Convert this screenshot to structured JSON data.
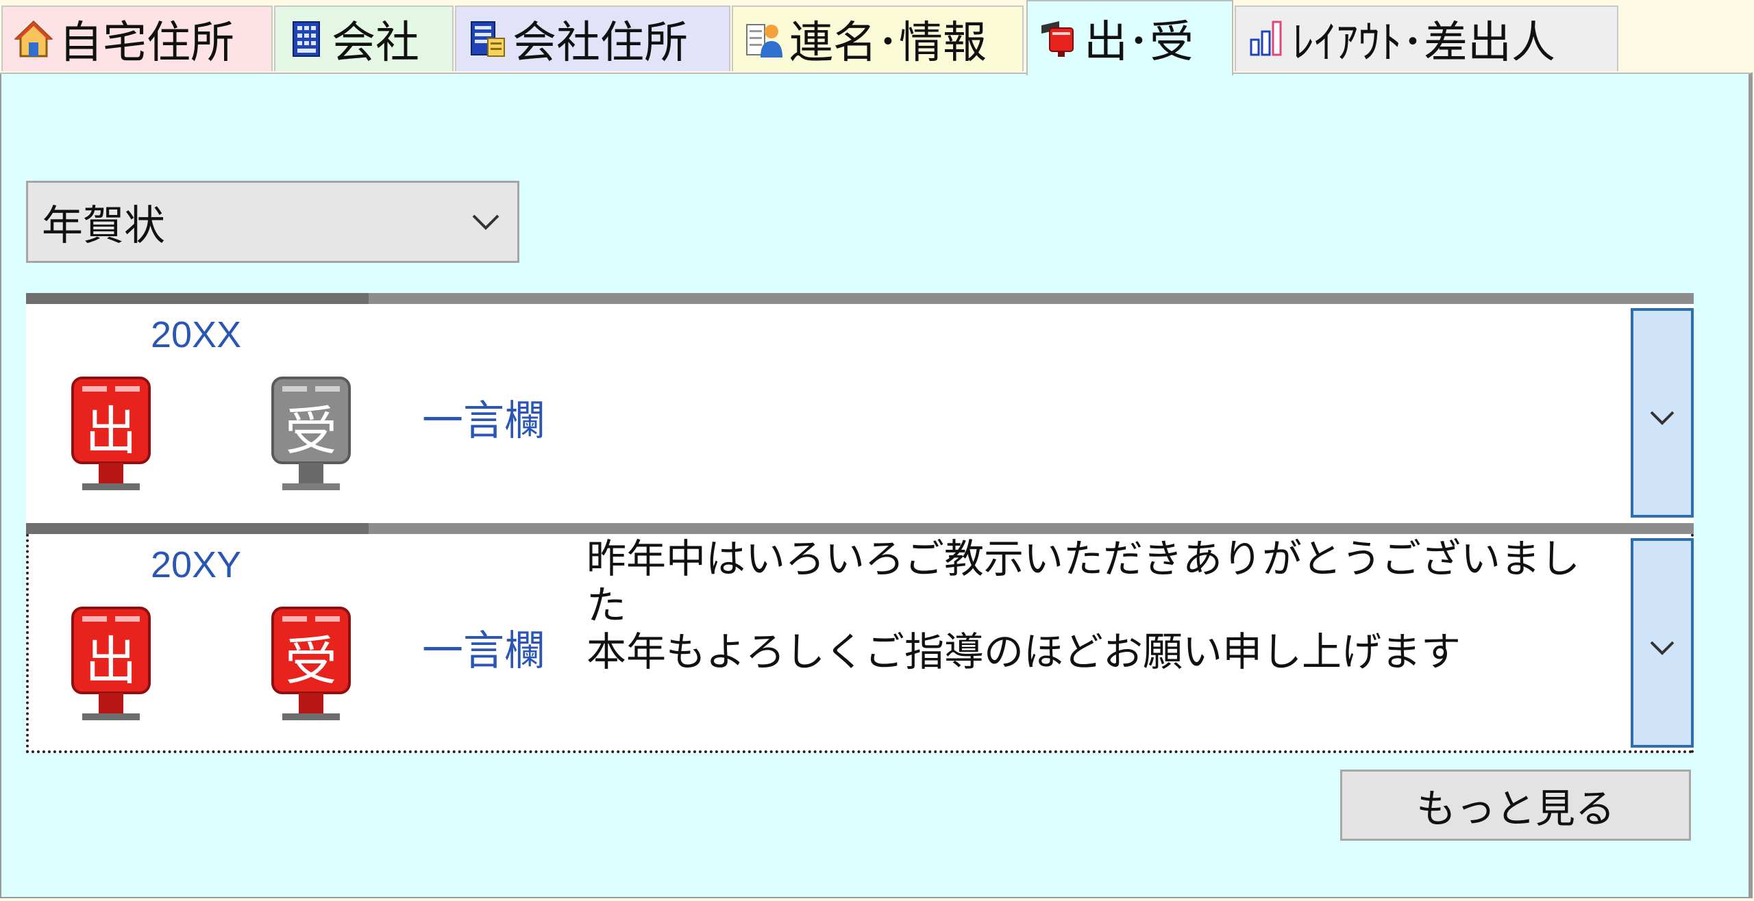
{
  "tabs": [
    {
      "label": "自宅住所",
      "icon": "house-icon",
      "color": "#fde3e6"
    },
    {
      "label": "会社",
      "icon": "building-icon",
      "color": "#e4f7e4"
    },
    {
      "label": "会社住所",
      "icon": "company-address-icon",
      "color": "#e2e2f8"
    },
    {
      "label": "連名･情報",
      "icon": "person-info-icon",
      "color": "#fbfbd8"
    },
    {
      "label": "出･受",
      "icon": "mailbox-icon",
      "color": "#ddffff",
      "active": true
    },
    {
      "label": "ﾚｲｱｳﾄ･差出人",
      "icon": "layout-chart-icon",
      "color": "#eeeeee"
    }
  ],
  "category_select": {
    "value": "年賀状"
  },
  "records": [
    {
      "year": "20XX",
      "sent": true,
      "received": false,
      "sent_label": "出",
      "received_label": "受",
      "comment_label": "一言欄",
      "message": ""
    },
    {
      "year": "20XY",
      "sent": true,
      "received": true,
      "sent_label": "出",
      "received_label": "受",
      "comment_label": "一言欄",
      "message": "昨年中はいろいろご教示いただきありがとうございました\n本年もよろしくご指導のほどお願い申し上げます"
    }
  ],
  "more_button": {
    "label": "もっと見る"
  },
  "colors": {
    "panel_bg": "#ddffff",
    "stamp_active": "#e8231e",
    "stamp_inactive": "#8b8b8b",
    "link_text": "#2a57b5",
    "expand_border": "#2d6fad"
  }
}
